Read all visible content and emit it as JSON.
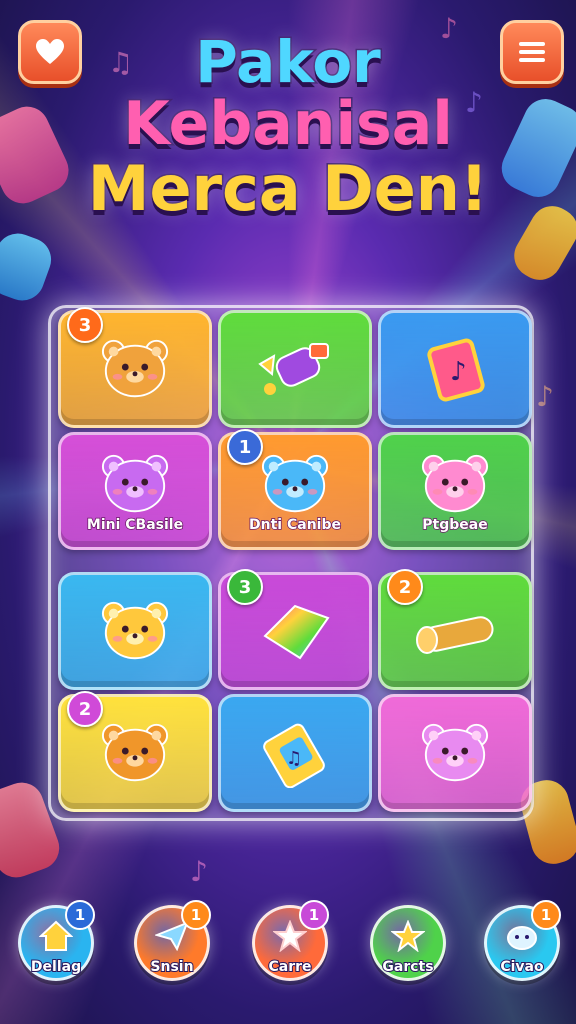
{
  "header": {
    "title_lines": [
      "Pakor",
      "Kebanisal",
      "Merca Den!"
    ],
    "favorite_icon": "heart-icon",
    "menu_icon": "hamburger-menu-icon"
  },
  "board": {
    "tiles": [
      {
        "color": "#ffb52e",
        "icon": "bear-with-box-icon",
        "badge": "3",
        "badge_color": "#ff6a1a",
        "label": ""
      },
      {
        "color": "#5fdc3c",
        "icon": "candy-items-icon",
        "badge": "",
        "badge_color": "",
        "label": ""
      },
      {
        "color": "#3a9af0",
        "icon": "music-card-icon",
        "badge": "",
        "badge_color": "",
        "label": ""
      },
      {
        "color": "#d64fd8",
        "icon": "purple-bear-icon",
        "badge": "",
        "badge_color": "",
        "label": "Mini CBasile"
      },
      {
        "color": "#ff9a2e",
        "icon": "blue-bear-icon",
        "badge": "1",
        "badge_color": "#3a6ad8",
        "label": "Dnti Canibe"
      },
      {
        "color": "#4fd24a",
        "icon": "pink-bear-hearts-icon",
        "badge": "",
        "badge_color": "",
        "label": "Ptgbeae"
      },
      {
        "color": "#3ab8f0",
        "icon": "yellow-bear-icon",
        "badge": "",
        "badge_color": "",
        "label": ""
      },
      {
        "color": "#c84ad8",
        "icon": "rainbow-gem-icon",
        "badge": "3",
        "badge_color": "#3ab83a",
        "label": ""
      },
      {
        "color": "#5fdc3c",
        "icon": "scroll-roll-icon",
        "badge": "2",
        "badge_color": "#ff8a1a",
        "label": ""
      },
      {
        "color": "#ffe23c",
        "icon": "orange-bear-icon",
        "badge": "2",
        "badge_color": "#d04ad8",
        "label": ""
      },
      {
        "color": "#3aa8f0",
        "icon": "battery-music-icon",
        "badge": "",
        "badge_color": "",
        "label": ""
      },
      {
        "color": "#f06ad8",
        "icon": "lilac-bear-hearts-icon",
        "badge": "",
        "badge_color": "",
        "label": ""
      }
    ]
  },
  "nav": {
    "items": [
      {
        "label": "Dellag",
        "icon": "home-icon",
        "color": "#2ab4f0",
        "badge": "1",
        "badge_color": "#2a6ad8"
      },
      {
        "label": "Snsin",
        "icon": "paper-plane-icon",
        "color": "#ff7a2a",
        "badge": "1",
        "badge_color": "#ff8a1a"
      },
      {
        "label": "Carre",
        "icon": "star-icon",
        "color": "#ff6a3a",
        "badge": "1",
        "badge_color": "#c84ad8"
      },
      {
        "label": "Garcts",
        "icon": "gold-star-icon",
        "color": "#4fd24a",
        "badge": "",
        "badge_color": ""
      },
      {
        "label": "Civao",
        "icon": "cloud-character-icon",
        "color": "#2ac8f0",
        "badge": "1",
        "badge_color": "#ff8a1a"
      }
    ]
  }
}
